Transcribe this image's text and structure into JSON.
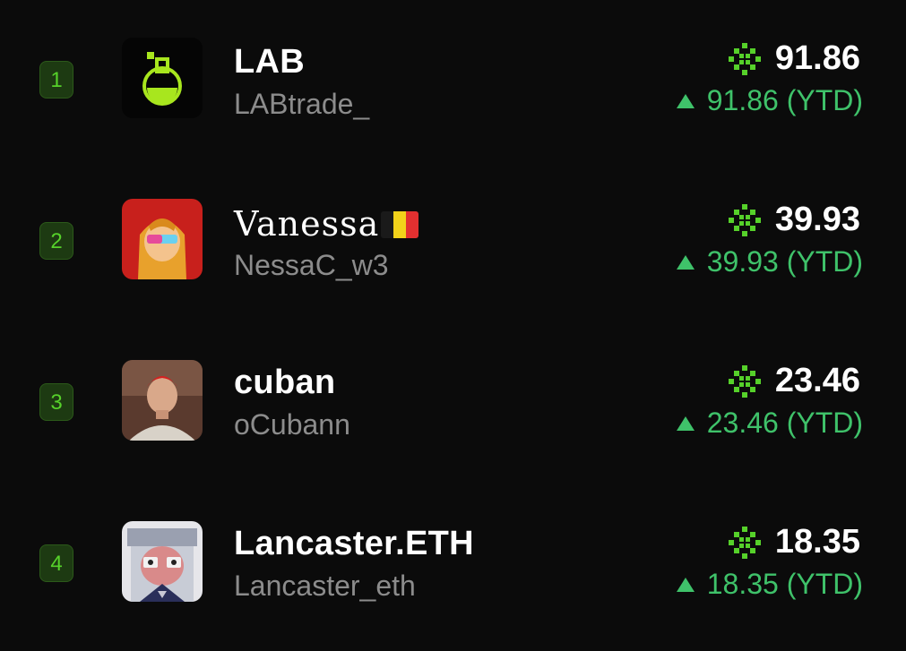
{
  "leaderboard": [
    {
      "rank": "1",
      "name": "LAB",
      "handle": "LABtrade_",
      "score": "91.86",
      "change": "91.86 (YTD)",
      "avatar": "flask-logo"
    },
    {
      "rank": "2",
      "name": "Vanessa",
      "handle": "NessaC_w3",
      "score": "39.93",
      "change": "39.93 (YTD)",
      "avatar": "cartoon-girl",
      "flag": "belgium-flag"
    },
    {
      "rank": "3",
      "name": "cuban",
      "handle": "oCubann",
      "score": "23.46",
      "change": "23.46 (YTD)",
      "avatar": "photo-man"
    },
    {
      "rank": "4",
      "name": "Lancaster.ETH",
      "handle": "Lancaster_eth",
      "score": "18.35",
      "change": "18.35 (YTD)",
      "avatar": "pixel-pig"
    }
  ],
  "colors": {
    "background": "#0b0b0b",
    "rank_badge": "#1d3a12",
    "rank_text": "#56d12a",
    "positive": "#3fc26a",
    "handle": "#8c8c8c"
  },
  "icons": {
    "points": "pixel-burst-icon",
    "change": "up-triangle-icon"
  }
}
